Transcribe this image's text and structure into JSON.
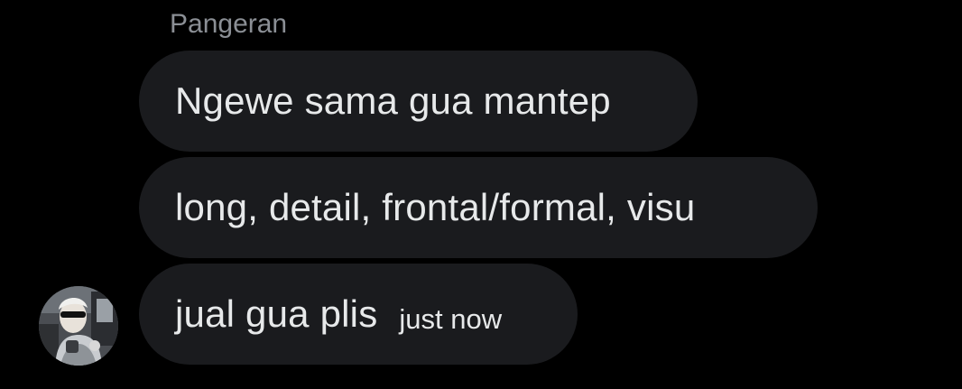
{
  "conversation": {
    "sender_name": "Pangeran",
    "messages": [
      {
        "text": "Ngewe sama gua mantep"
      },
      {
        "text": "long, detail, frontal/formal, visu"
      },
      {
        "text": "jual gua plis",
        "timestamp": "just now"
      }
    ]
  },
  "avatar": {
    "icon": "user-photo-avatar"
  }
}
